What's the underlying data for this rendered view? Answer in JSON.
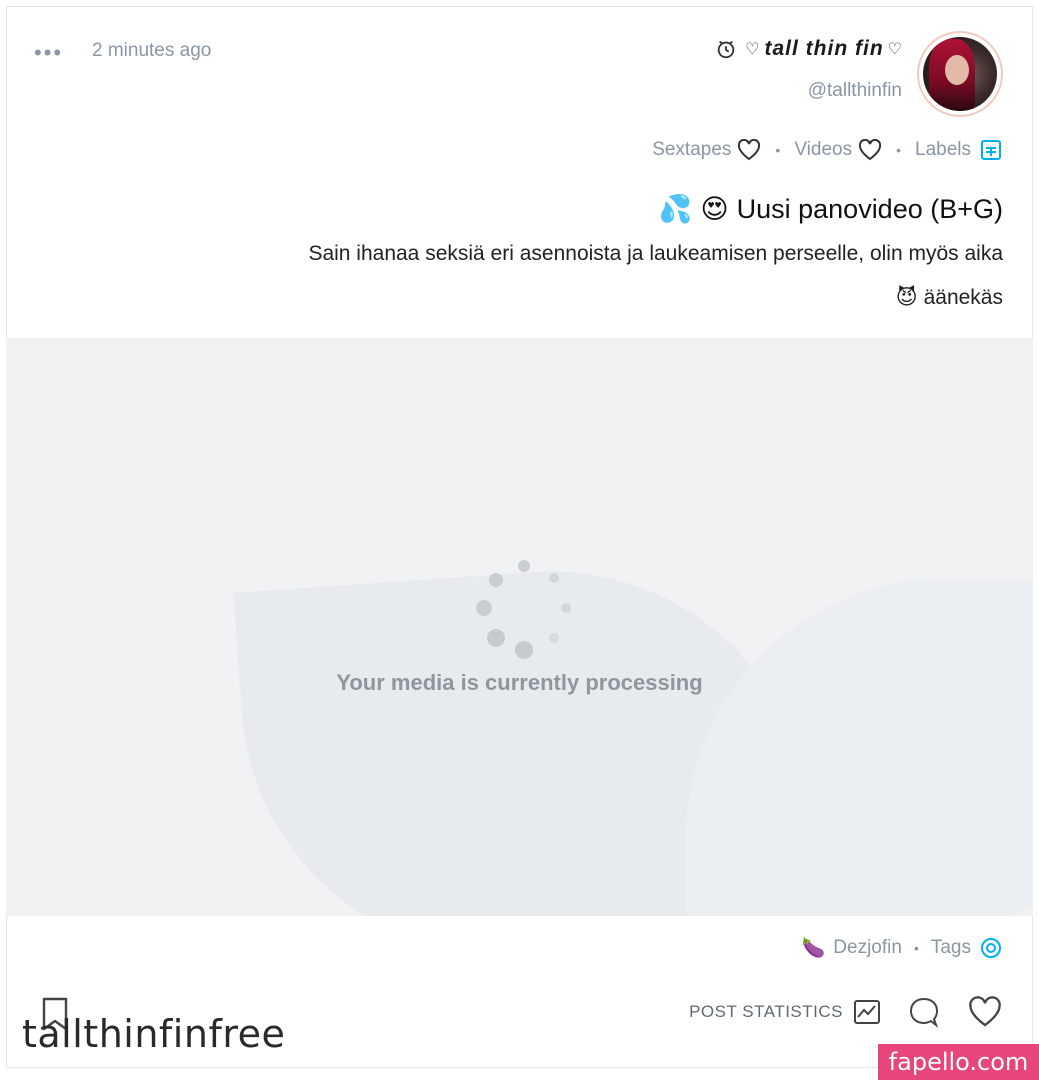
{
  "post": {
    "display_name": "tall thin fin",
    "handle": "@tallthinfin",
    "time_ago": "2 minutes ago",
    "more_label": "•••",
    "labels_heading": "Labels",
    "labels": [
      "Videos",
      "Sextapes"
    ],
    "title": "Uusi panovideo (B+G)",
    "title_emojis": [
      "😍",
      "💦"
    ],
    "body_line1": "Sain ihanaa seksiä eri asennoista ja laukeamisen perseelle, olin myös aika",
    "body_line2": "äänekäs",
    "body_emoji": "😈"
  },
  "media": {
    "status_text": "Your media is currently processing"
  },
  "footer": {
    "tags_heading": "Tags",
    "tags": [
      "Dezjofin"
    ],
    "tag_emoji": "🍆",
    "stats_label": "POST STATISTICS"
  },
  "watermark": {
    "name": "tallthinfinfree",
    "site": "fapello.com"
  },
  "colors": {
    "secondary_text": "#8a96a3",
    "media_bg": "#f0f2f4",
    "accent_blue": "#00aff0",
    "watermark_pink": "#e8457a"
  },
  "icons": [
    "heart-icon",
    "clock-icon",
    "label-icon",
    "tag-icon",
    "like-icon",
    "comment-icon",
    "statistics-icon",
    "bookmark-icon",
    "loading-spinner"
  ]
}
